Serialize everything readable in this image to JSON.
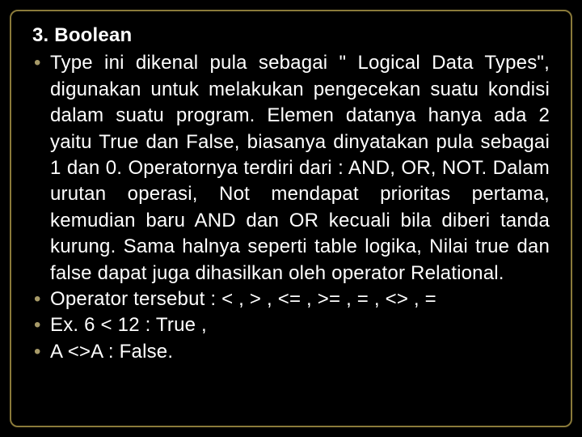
{
  "slide": {
    "heading": "3. Boolean",
    "bullets": [
      "Type ini dikenal pula sebagai \" Logical Data Types\", digunakan untuk melakukan pengecekan suatu kondisi dalam suatu program. Elemen datanya hanya ada 2 yaitu True dan False, biasanya dinyatakan pula sebagai 1 dan 0. Operatornya terdiri dari : AND, OR, NOT. Dalam urutan operasi, Not mendapat prioritas pertama, kemudian baru AND dan OR kecuali bila diberi tanda kurung. Sama halnya seperti table logika, Nilai true dan false dapat juga dihasilkan oleh operator Relational.",
      "Operator tersebut : < , > , <= , >= , = , <> , =",
      "Ex. 6 < 12 : True ,",
      "A <>A : False."
    ]
  }
}
